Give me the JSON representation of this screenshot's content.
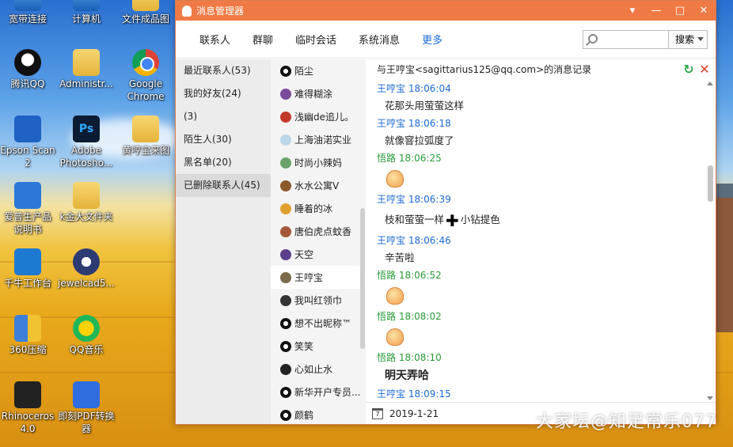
{
  "desktop": {
    "icons": [
      {
        "label": "宽带连接"
      },
      {
        "label": "计算机"
      },
      {
        "label": "文件成品图"
      },
      {
        "label": "腾讯QQ"
      },
      {
        "label": "Administr..."
      },
      {
        "label": "Google\nChrome"
      },
      {
        "label": "Epson Scan\n2"
      },
      {
        "label": "Adobe\nPhotosho..."
      },
      {
        "label": "黄哼宝来图"
      },
      {
        "label": "爱普生产品\n说明书"
      },
      {
        "label": "k金大文件夹"
      },
      {
        "label": "千牛工作台"
      },
      {
        "label": "jewelcad5..."
      },
      {
        "label": "360压缩"
      },
      {
        "label": "QQ音乐"
      },
      {
        "label": "Rhinoceros\n4.0"
      },
      {
        "label": "即刻PDF转换\n器"
      }
    ]
  },
  "window": {
    "title": "消息管理器",
    "controls": {
      "menu": "▾",
      "minimize": "—",
      "maximize": "□",
      "close": "✕"
    },
    "tabs": [
      "联系人",
      "群聊",
      "临时会话",
      "系统消息",
      "更多"
    ],
    "active_tab": "更多",
    "search": {
      "placeholder": "",
      "button": "搜索"
    },
    "groups": [
      "最近联系人(53)",
      "我的好友(24)",
      "(3)",
      "陌生人(30)",
      "黑名单(20)",
      "已删除联系人(45)"
    ],
    "selected_group": "已删除联系人(45)",
    "contacts": [
      "陌尘",
      "难得糊涂",
      "浅幽de追儿。",
      "上海油渃实业",
      "时尚小辣妈",
      "水水公寓V",
      "睡着的冰",
      "唐伯虎点蚊香",
      "天空",
      "王哼宝",
      "我叫红领巾",
      "想不出昵称™",
      "笑笑",
      "心如止水",
      "新华开户专员...",
      "颜鹤"
    ],
    "selected_contact": "王哼宝",
    "chat_header": "与王哼宝<sagittarius125@qq.com>的消息记录",
    "messages": [
      {
        "sender": "王哼宝",
        "time": "18:06:04",
        "text": "花那头用萤萤这样"
      },
      {
        "sender": "王哼宝",
        "time": "18:06:18",
        "text": "就像窨拉弧度了"
      },
      {
        "sender": "悟路",
        "time": "18:06:25",
        "text": ""
      },
      {
        "sender": "王哼宝",
        "time": "18:06:39",
        "text_a": "枝和萤萤一样",
        "text_b": "小钻提色"
      },
      {
        "sender": "王哼宝",
        "time": "18:06:46",
        "text": "辛苦啦"
      },
      {
        "sender": "悟路",
        "time": "18:06:52",
        "text": ""
      },
      {
        "sender": "悟路",
        "time": "18:08:02",
        "text": ""
      },
      {
        "sender": "悟路",
        "time": "18:08:10",
        "text": "明天弄哈"
      },
      {
        "sender": "王哼宝",
        "time": "18:09:15",
        "text": ""
      }
    ],
    "footer_date": "2019-1-21",
    "colors": {
      "titlebar": "#f07a45",
      "self_name": "#2a9a3a",
      "other_name": "#1e6bd6"
    }
  },
  "watermark": "大家坛@知足常乐077"
}
